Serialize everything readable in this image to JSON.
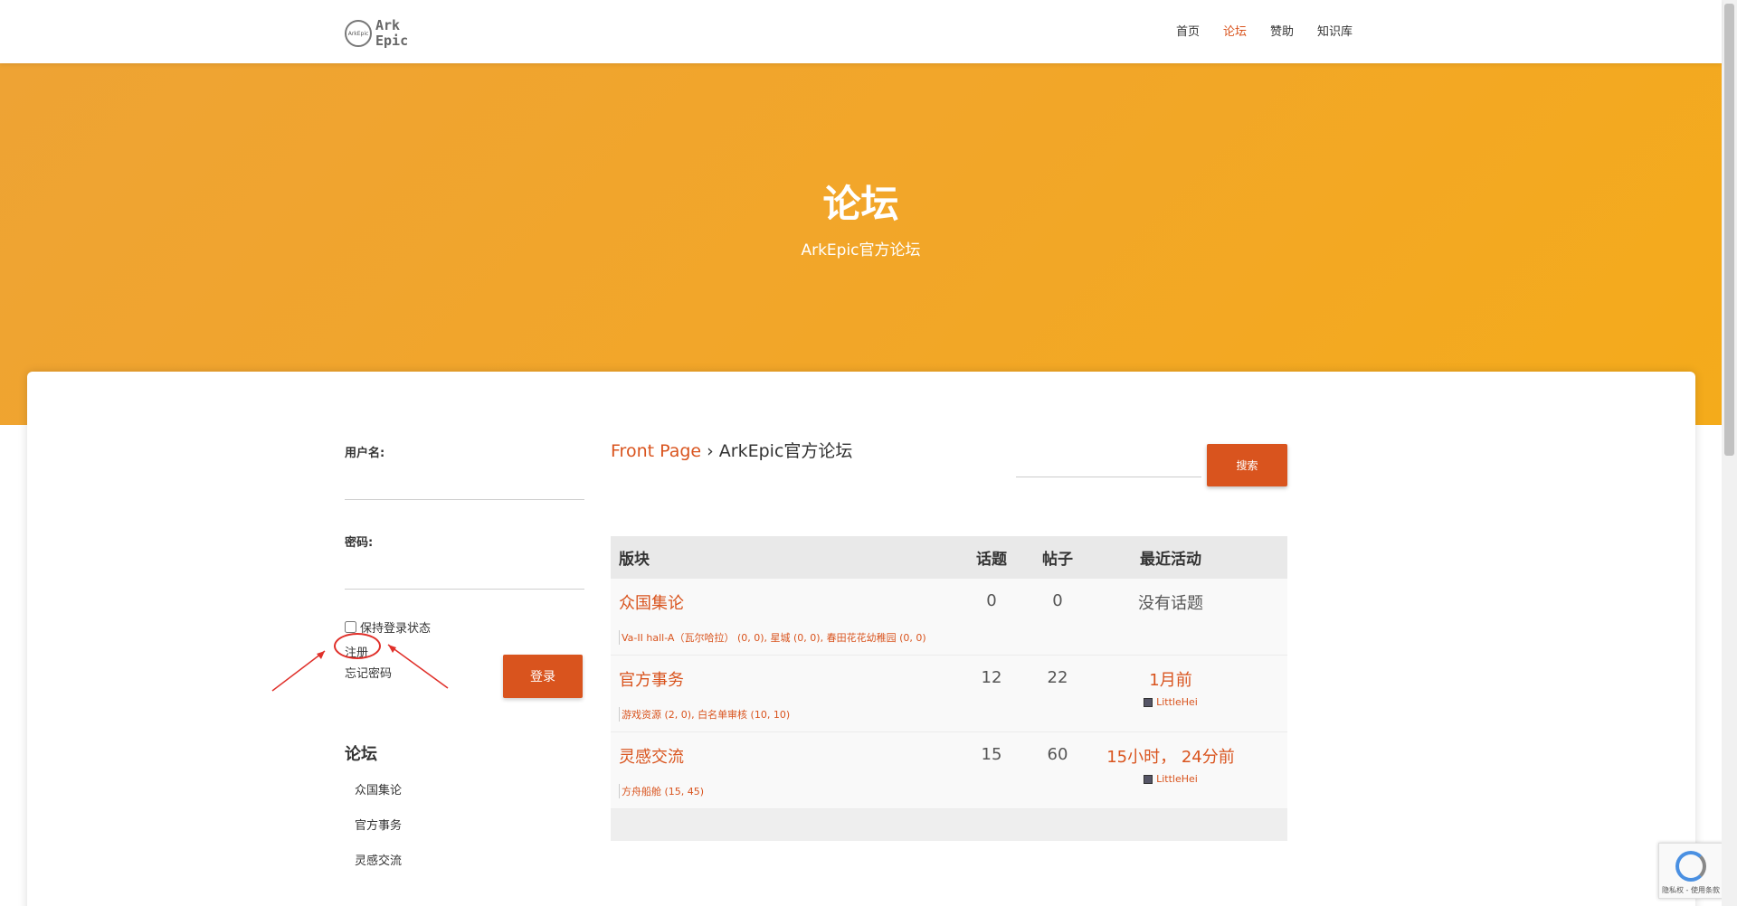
{
  "header": {
    "logo_text_1": "Ark",
    "logo_text_2": "Epic",
    "logo_badge": "ArkEpic",
    "nav": [
      {
        "label": "首页"
      },
      {
        "label": "论坛"
      },
      {
        "label": "赞助"
      },
      {
        "label": "知识库"
      }
    ]
  },
  "hero": {
    "title": "论坛",
    "subtitle": "ArkEpic官方论坛"
  },
  "login": {
    "username_label": "用户名:",
    "password_label": "密码:",
    "remember_label": "保持登录状态",
    "register_link": "注册",
    "forgot_link": "忘记密码",
    "login_button": "登录"
  },
  "sidebar": {
    "forum_heading": "论坛",
    "forums": [
      "众国集论",
      "官方事务",
      "灵感交流"
    ]
  },
  "breadcrumb": {
    "front_page": "Front Page",
    "separator": "›",
    "current": "ArkEpic官方论坛"
  },
  "search": {
    "button": "搜索"
  },
  "table": {
    "headers": {
      "board": "版块",
      "topics": "话题",
      "posts": "帖子",
      "recent": "最近活动"
    },
    "rows": [
      {
        "name": "众国集论",
        "topics": "0",
        "posts": "0",
        "recent": "没有话题",
        "user": "",
        "sub": "Va-II hall-A（瓦尔哈拉） (0, 0), 星城 (0, 0), 春田花花幼稚园 (0, 0)"
      },
      {
        "name": "官方事务",
        "topics": "12",
        "posts": "22",
        "recent": "1月前",
        "user": "LittleHei",
        "sub": "游戏资源 (2, 0), 白名单审核 (10, 10)"
      },
      {
        "name": "灵感交流",
        "topics": "15",
        "posts": "60",
        "recent": "15小时， 24分前",
        "user": "LittleHei",
        "sub": "方舟船舱 (15, 45)"
      }
    ]
  },
  "recaptcha": {
    "text": "隐私权 - 使用条款"
  },
  "colors": {
    "accent": "#d9541e",
    "hero": "#f2a629"
  }
}
